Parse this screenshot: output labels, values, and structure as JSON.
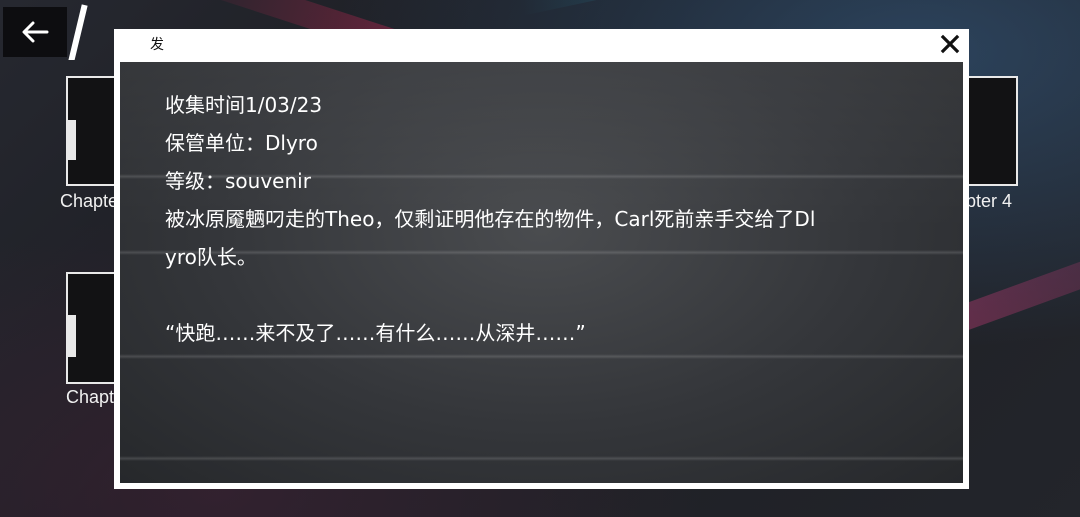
{
  "header": {
    "back_icon": "arrow-left-icon"
  },
  "chapters": {
    "left_top_label": "Chapte",
    "left_bottom_label": "Chapt",
    "right_top_label": "pter 4"
  },
  "modal": {
    "title": "发",
    "close_icon": "close-x-icon",
    "lines": {
      "collect_time": "收集时间1/03/23",
      "custodian": "保管单位：Dlyro",
      "level": "等级：souvenir",
      "description_1": "被冰原魇魉叼走的Theo，仅剩证明他存在的物件，Carl死前亲手交给了Dl",
      "description_2": "yro队长。",
      "quote": "“快跑……来不及了……有什么……从深井……”"
    }
  },
  "colors": {
    "modal_frame": "#ffffff",
    "text": "#ffffff",
    "panel": "#3a3c40"
  }
}
